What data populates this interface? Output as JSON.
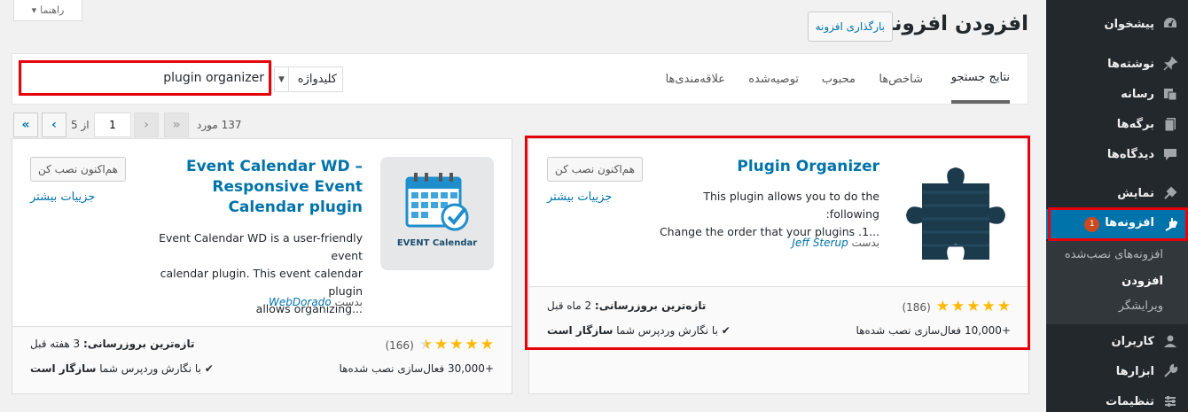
{
  "page": {
    "title": "افزودن افزونه",
    "upload_button": "بارگذاری افزونه",
    "help_tab": "راهنما"
  },
  "sidebar": {
    "items": [
      {
        "label": "پیشخوان",
        "icon": "dashboard-icon"
      },
      {
        "label": "نوشته‌ها",
        "icon": "pin-icon"
      },
      {
        "label": "رسانه",
        "icon": "media-icon"
      },
      {
        "label": "برگه‌ها",
        "icon": "pages-icon"
      },
      {
        "label": "دیدگاه‌ها",
        "icon": "comments-icon"
      },
      {
        "label": "نمایش",
        "icon": "appearance-icon"
      },
      {
        "label": "افزونه‌ها",
        "icon": "plugins-icon",
        "badge": "1"
      },
      {
        "label": "کاربران",
        "icon": "users-icon"
      },
      {
        "label": "ابزارها",
        "icon": "tools-icon"
      },
      {
        "label": "تنظیمات",
        "icon": "settings-icon"
      }
    ],
    "submenu": [
      "افزونه‌های نصب‌شده",
      "افزودن",
      "ویرایشگر"
    ]
  },
  "filter": {
    "tabs": [
      "نتایج جستجو",
      "شاخص‌ها",
      "محبوب",
      "توصیه‌شده",
      "علاقه‌مندی‌ها"
    ],
    "search_type": "کلیدواژه",
    "search_value": "plugin organizer"
  },
  "pagination": {
    "items": "137 مورد",
    "first": "«",
    "prev": "‹",
    "current_page": "1",
    "of_label": "از 5",
    "next": "›",
    "last": "»"
  },
  "plugins": [
    {
      "name": "Plugin Organizer",
      "description_line1": "This plugin allows you to do the following:",
      "description_line2": "...1. Change the order that your plugins",
      "author_prefix": "بدست",
      "author": "Jeff Sterup",
      "install_label": "هم‌اکنون نصب کن",
      "details_label": "جزییات بیشتر",
      "rating": 5,
      "rating_count": "(186)",
      "installs": "+10,000 فعال‌سازی نصب شده‌ها",
      "last_updated_label": "تازه‌ترین بروزرسانی:",
      "last_updated_value": "2 ماه قبل",
      "compat_text": "با نگارش وردپرس شما",
      "compat_strong": "سازگار است"
    },
    {
      "name": "Event Calendar WD – Responsive Event Calendar plugin",
      "description_line1": "Event Calendar WD is a user-friendly event",
      "description_line2": "calendar plugin. This event calendar plugin",
      "description_line3": "...allows organizing",
      "icon_caption": "EVENT Calendar",
      "author_prefix": "بدست",
      "author": "WebDorado",
      "install_label": "هم‌اکنون نصب کن",
      "details_label": "جزییات بیشتر",
      "rating": 4.5,
      "rating_count": "(166)",
      "installs": "+30,000 فعال‌سازی نصب شده‌ها",
      "last_updated_label": "تازه‌ترین بروزرسانی:",
      "last_updated_value": "3 هفته قبل",
      "compat_text": "با نگارش وردپرس شما",
      "compat_strong": "سازگار است"
    }
  ],
  "colors": {
    "accent": "#0073aa",
    "sidebar_bg": "#23282d",
    "highlight_red": "#e6020a",
    "star": "#ffb900"
  }
}
